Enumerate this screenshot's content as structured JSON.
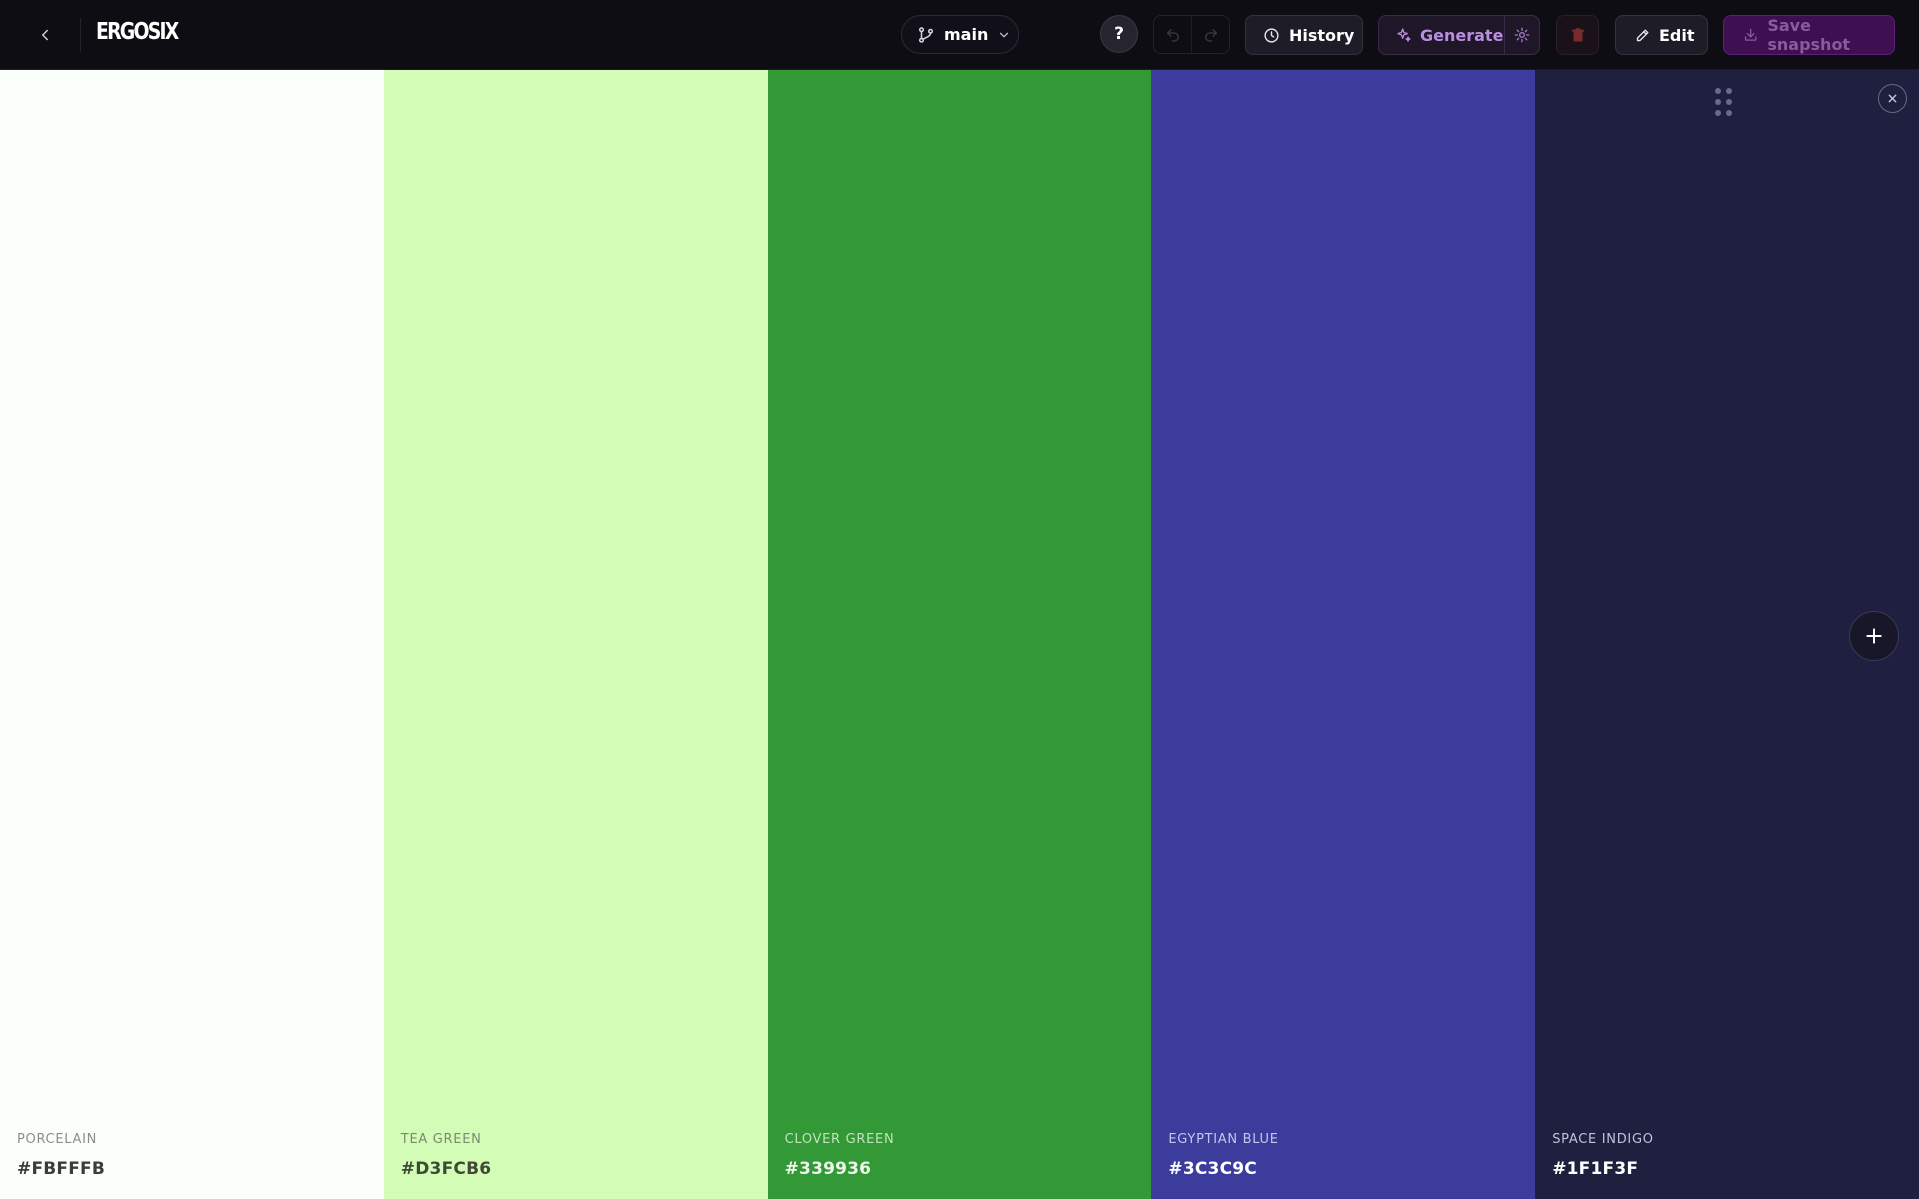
{
  "app": {
    "logo_text": "ERGOSIX"
  },
  "toolbar": {
    "branch_label": "main",
    "help_label": "?",
    "history_label": "History",
    "generate_label": "Generate",
    "edit_label": "Edit",
    "save_label": "Save snapshot"
  },
  "icons": {
    "back": "chevron-left-icon",
    "branch": "git-branch-icon",
    "branch_dropdown": "chevron-down-icon",
    "undo": "undo-icon",
    "redo": "redo-icon",
    "history": "clock-icon",
    "generate": "sparkle-icon",
    "generate_settings": "gear-icon",
    "delete": "trash-icon",
    "edit": "pencil-icon",
    "save": "download-icon",
    "drag": "drag-handle-icon",
    "close": "close-icon",
    "add": "plus-icon"
  },
  "colors": {
    "topbar_bg": "#0e0d14",
    "generate_text": "#b98de0",
    "save_bg": "#3e1052",
    "delete_icon": "#7a2a2a"
  },
  "palette": {
    "swatches": [
      {
        "name": "PORCELAIN",
        "hex": "#FBFFFB",
        "color": "#FBFFFB",
        "text_color": "#3a3d3a",
        "name_color": "#8a8e8a"
      },
      {
        "name": "TEA GREEN",
        "hex": "#D3FCB6",
        "color": "#D3FCB6",
        "text_color": "#3f4a36",
        "name_color": "#7d8a72"
      },
      {
        "name": "CLOVER GREEN",
        "hex": "#339936",
        "color": "#339936",
        "text_color": "#ecf7ec",
        "name_color": "#bfe3c0"
      },
      {
        "name": "EGYPTIAN BLUE",
        "hex": "#3C3C9C",
        "color": "#3C3C9C",
        "text_color": "#ffffff",
        "name_color": "#c6c6ea"
      },
      {
        "name": "SPACE INDIGO",
        "hex": "#1F1F3F",
        "color": "#1F1F3F",
        "text_color": "#ffffff",
        "name_color": "#c2c2d8"
      }
    ]
  }
}
